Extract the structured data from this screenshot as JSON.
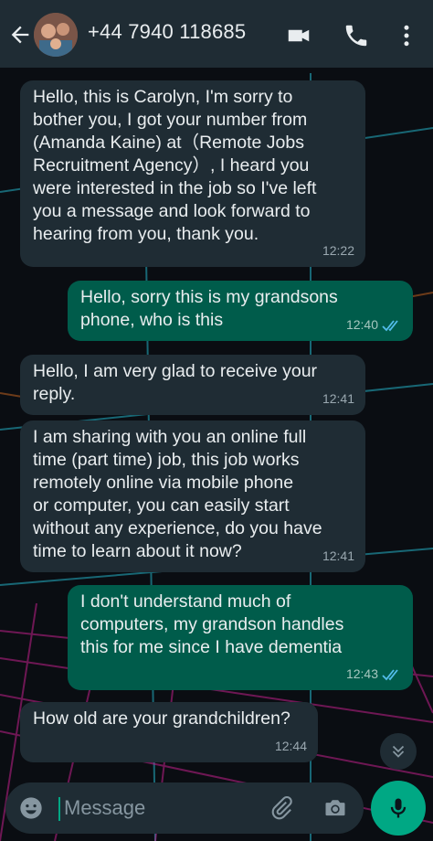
{
  "header": {
    "contact_title": "+44 7940 118685",
    "icons": [
      "back-arrow-icon",
      "avatar",
      "video-call-icon",
      "phone-call-icon",
      "more-options-icon"
    ]
  },
  "messages": [
    {
      "direction": "incoming",
      "text": "Hello, this is Carolyn, I'm sorry to\nbother you, I got your number from\n(Amanda Kaine) at（Remote Jobs\nRecruitment Agency）, I heard you\nwere interested in the job so I've left\nyou a message and look forward to\nhearing from you, thank you.",
      "time": "12:22"
    },
    {
      "direction": "outgoing",
      "text": "Hello, sorry this is my grandsons\nphone, who is this",
      "time": "12:40",
      "status": "read"
    },
    {
      "direction": "incoming",
      "text": "Hello, I am very glad to receive your\nreply.",
      "time": "12:41"
    },
    {
      "direction": "incoming",
      "text": "I am sharing with you an online full\ntime (part time) job, this job works\nremotely online via mobile phone\nor computer, you can easily start\nwithout any experience, do you have\ntime to learn about it now?",
      "time": "12:41"
    },
    {
      "direction": "outgoing",
      "text": "I don't understand much of\ncomputers, my grandson handles\nthis for me since I have dementia",
      "time": "12:43",
      "status": "read"
    },
    {
      "direction": "incoming",
      "text": "How old are your grandchildren?",
      "time": "12:44"
    }
  ],
  "composer": {
    "placeholder": "Message",
    "icons": [
      "emoji-icon",
      "attach-icon",
      "camera-icon",
      "mic-icon"
    ]
  },
  "colors": {
    "header_bg": "#1f2c34",
    "incoming_bubble": "#1f2c34",
    "outgoing_bubble": "#005c4b",
    "accent": "#00a884",
    "read_ticks": "#53bdeb"
  }
}
